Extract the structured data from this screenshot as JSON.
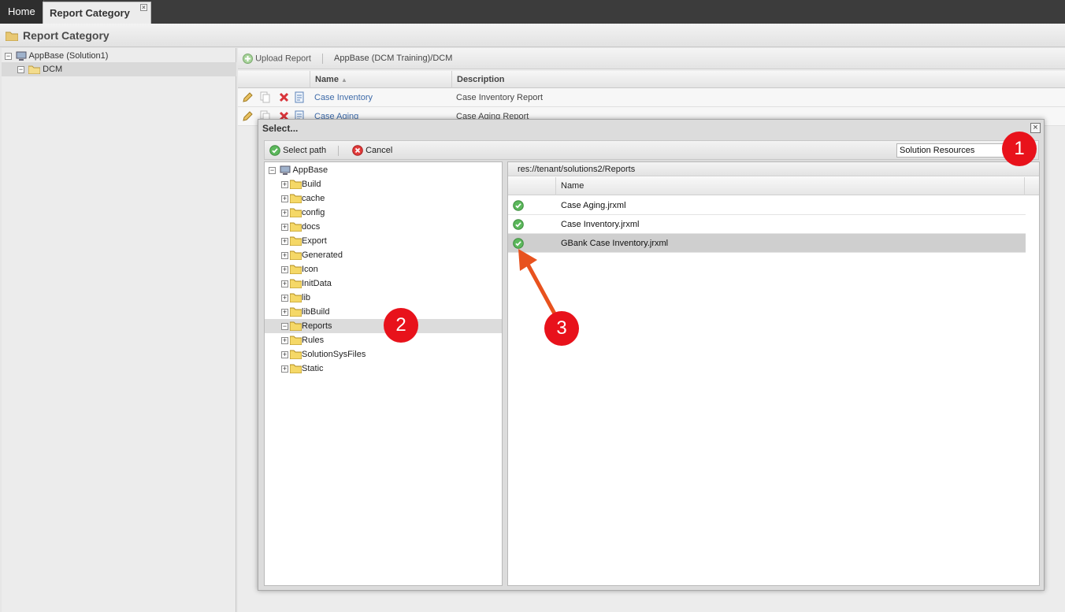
{
  "tabs": {
    "home": "Home",
    "active": "Report Category"
  },
  "page": {
    "title": "Report Category"
  },
  "left_tree": {
    "root": "AppBase (Solution1)",
    "child": "DCM"
  },
  "main": {
    "toolbar": {
      "upload": "Upload Report",
      "path": "AppBase (DCM Training)/DCM"
    },
    "columns": {
      "name": "Name",
      "description": "Description"
    },
    "rows": [
      {
        "name": "Case Inventory",
        "description": "Case Inventory Report"
      },
      {
        "name": "Case Aging",
        "description": "Case Aging Report"
      }
    ]
  },
  "dialog": {
    "title": "Select...",
    "select_path": "Select path",
    "cancel": "Cancel",
    "resource_select": "Solution Resources",
    "tree_root": "AppBase",
    "folders": [
      "Build",
      "cache",
      "config",
      "docs",
      "Export",
      "Generated",
      "Icon",
      "InitData",
      "lib",
      "libBuild",
      "Reports",
      "Rules",
      "SolutionSysFiles",
      "Static"
    ],
    "selected_folder": "Reports",
    "path": "res://tenant/solutions2/Reports",
    "files_column": "Name",
    "files": [
      "Case Aging.jrxml",
      "Case Inventory.jrxml",
      "GBank Case Inventory.jrxml"
    ],
    "selected_file": "GBank Case Inventory.jrxml"
  },
  "annotations": {
    "badge_1": "1",
    "badge_2": "2",
    "badge_3": "3",
    "arrow_color": "#e8521e",
    "badge_color": "#e8121b"
  }
}
